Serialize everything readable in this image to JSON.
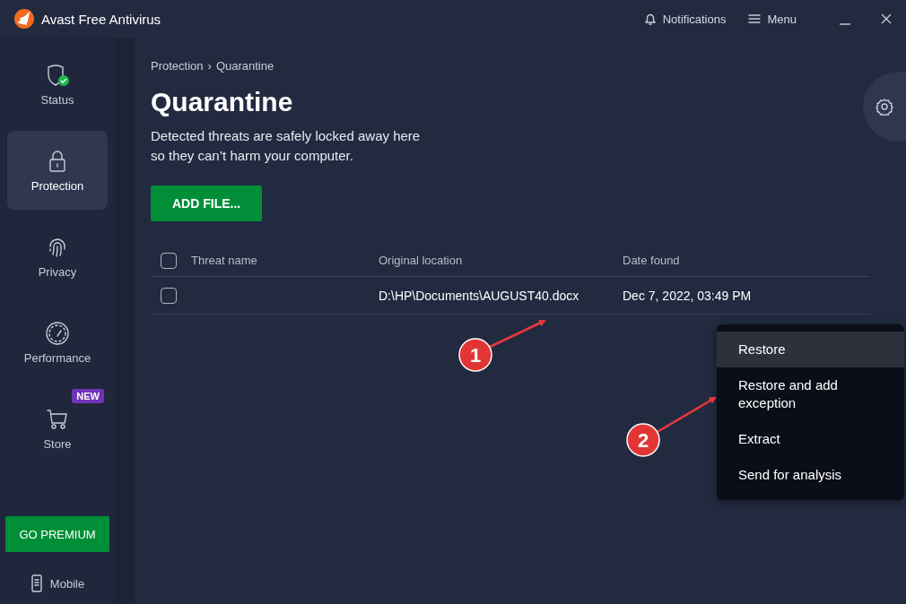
{
  "window": {
    "title": "Avast Free Antivirus",
    "actions": [
      {
        "kind": "notifications",
        "label": "Notifications"
      },
      {
        "kind": "menu",
        "label": "Menu"
      }
    ]
  },
  "sidebar": {
    "items": [
      {
        "kind": "status",
        "label": "Status",
        "selected": false
      },
      {
        "kind": "protection",
        "label": "Protection",
        "selected": true
      },
      {
        "kind": "privacy",
        "label": "Privacy",
        "selected": false
      },
      {
        "kind": "performance",
        "label": "Performance",
        "selected": false
      },
      {
        "kind": "store",
        "label": "Store",
        "selected": false,
        "badge": "NEW"
      }
    ],
    "premium_button": "GO PREMIUM",
    "mobile": "Mobile"
  },
  "breadcrumb": {
    "items": [
      "Protection",
      "Quarantine"
    ],
    "separator": "›"
  },
  "page": {
    "title": "Quarantine",
    "description": "Detected threats are safely locked away here\nso they can’t harm your computer.",
    "add_button": "ADD FILE..."
  },
  "table": {
    "select_all_checked": false,
    "columns": [
      "Threat name",
      "Original location",
      "Date found"
    ],
    "rows": [
      {
        "checked": false,
        "original_location": "D:\\HP\\Documents\\AUGUST40.docx",
        "date_found": "Dec 7, 2022, 03:49 PM"
      }
    ]
  },
  "context_menu": {
    "items": [
      {
        "label": "Restore",
        "selected": true
      },
      {
        "label": "Restore and add exception",
        "selected": false
      },
      {
        "label": "Extract",
        "selected": false
      },
      {
        "label": "Send for analysis",
        "selected": false
      }
    ]
  },
  "annotations": [
    {
      "label": "1"
    },
    {
      "label": "2"
    }
  ]
}
